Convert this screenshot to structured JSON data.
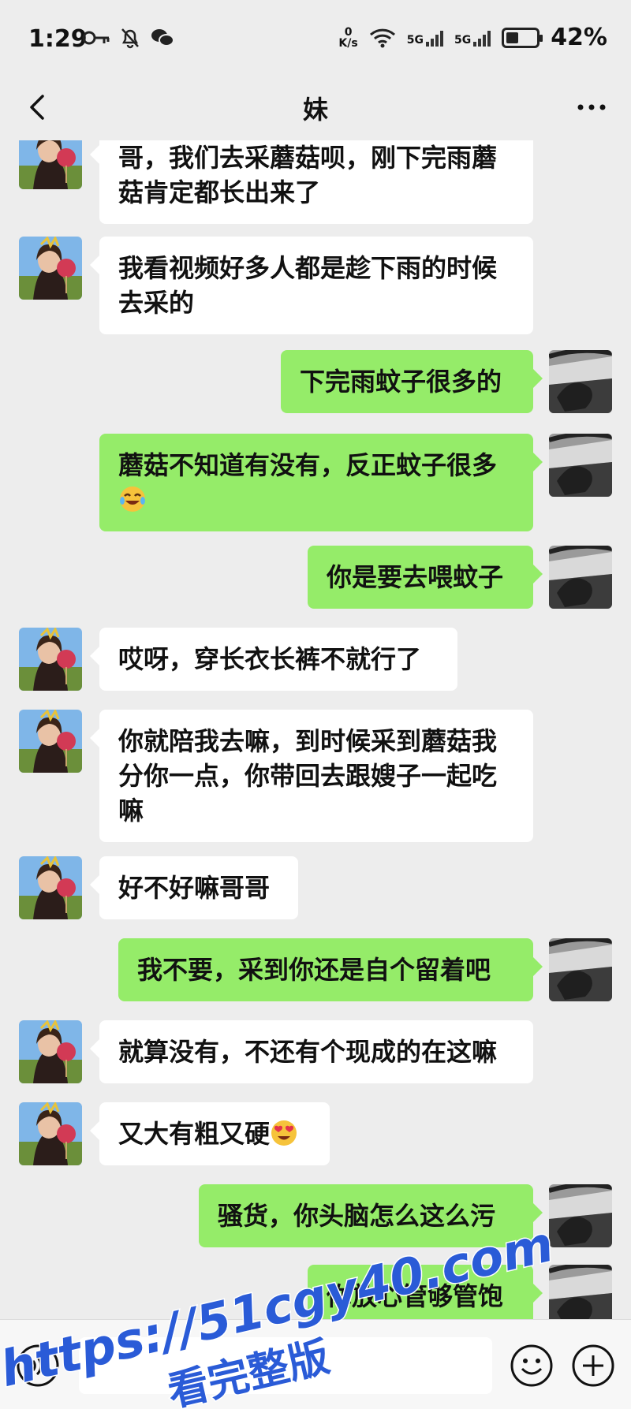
{
  "status_bar": {
    "time": "1:29",
    "speed_value": "0",
    "speed_unit": "K/s",
    "network1": "5G",
    "network2": "5G",
    "battery": "42%",
    "battery_level": 0.42
  },
  "header": {
    "title": "妹",
    "back_icon": "chevron-left-icon",
    "more_icon": "more-dots-icon"
  },
  "messages": [
    {
      "side": "in",
      "lines": [
        "哥，我们去采蘑菇呗，刚下完雨蘑",
        "菇肯定都长出来了"
      ]
    },
    {
      "side": "in",
      "lines": [
        "我看视频好多人都是趁下雨的时候",
        "去采的"
      ]
    },
    {
      "side": "out",
      "lines": [
        "下完雨蚊子很多的"
      ]
    },
    {
      "side": "out",
      "lines": [
        "蘑菇不知道有没有，反正蚊子很多"
      ],
      "emoji": "tears-of-joy"
    },
    {
      "side": "out",
      "lines": [
        "你是要去喂蚊子"
      ]
    },
    {
      "side": "in",
      "lines": [
        "哎呀，穿长衣长裤不就行了"
      ]
    },
    {
      "side": "in",
      "lines": [
        "你就陪我去嘛，到时候采到蘑菇我",
        "分你一点，你带回去跟嫂子一起吃",
        "嘛"
      ]
    },
    {
      "side": "in",
      "lines": [
        "好不好嘛哥哥"
      ]
    },
    {
      "side": "out",
      "lines": [
        "我不要，采到你还是自个留着吧"
      ]
    },
    {
      "side": "in",
      "lines": [
        "就算没有，不还有个现成的在这嘛"
      ]
    },
    {
      "side": "in",
      "lines": [
        "又大有粗又硬"
      ],
      "emoji": "heart-eyes"
    },
    {
      "side": "out",
      "lines": [
        "骚货，你头脑怎么这么污"
      ]
    },
    {
      "side": "out",
      "lines": [
        "你放心管够管饱"
      ]
    }
  ],
  "input_bar": {
    "voice_icon": "voice-icon",
    "emoji_icon": "smiley-icon",
    "plus_icon": "plus-circle-icon"
  },
  "watermark": {
    "line1": "https://51cgy40.com",
    "line2": "看完整版"
  },
  "colors": {
    "background": "#ededed",
    "outgoing_bubble": "#95ec69",
    "incoming_bubble": "#ffffff",
    "watermark": "#2a5bd7"
  }
}
